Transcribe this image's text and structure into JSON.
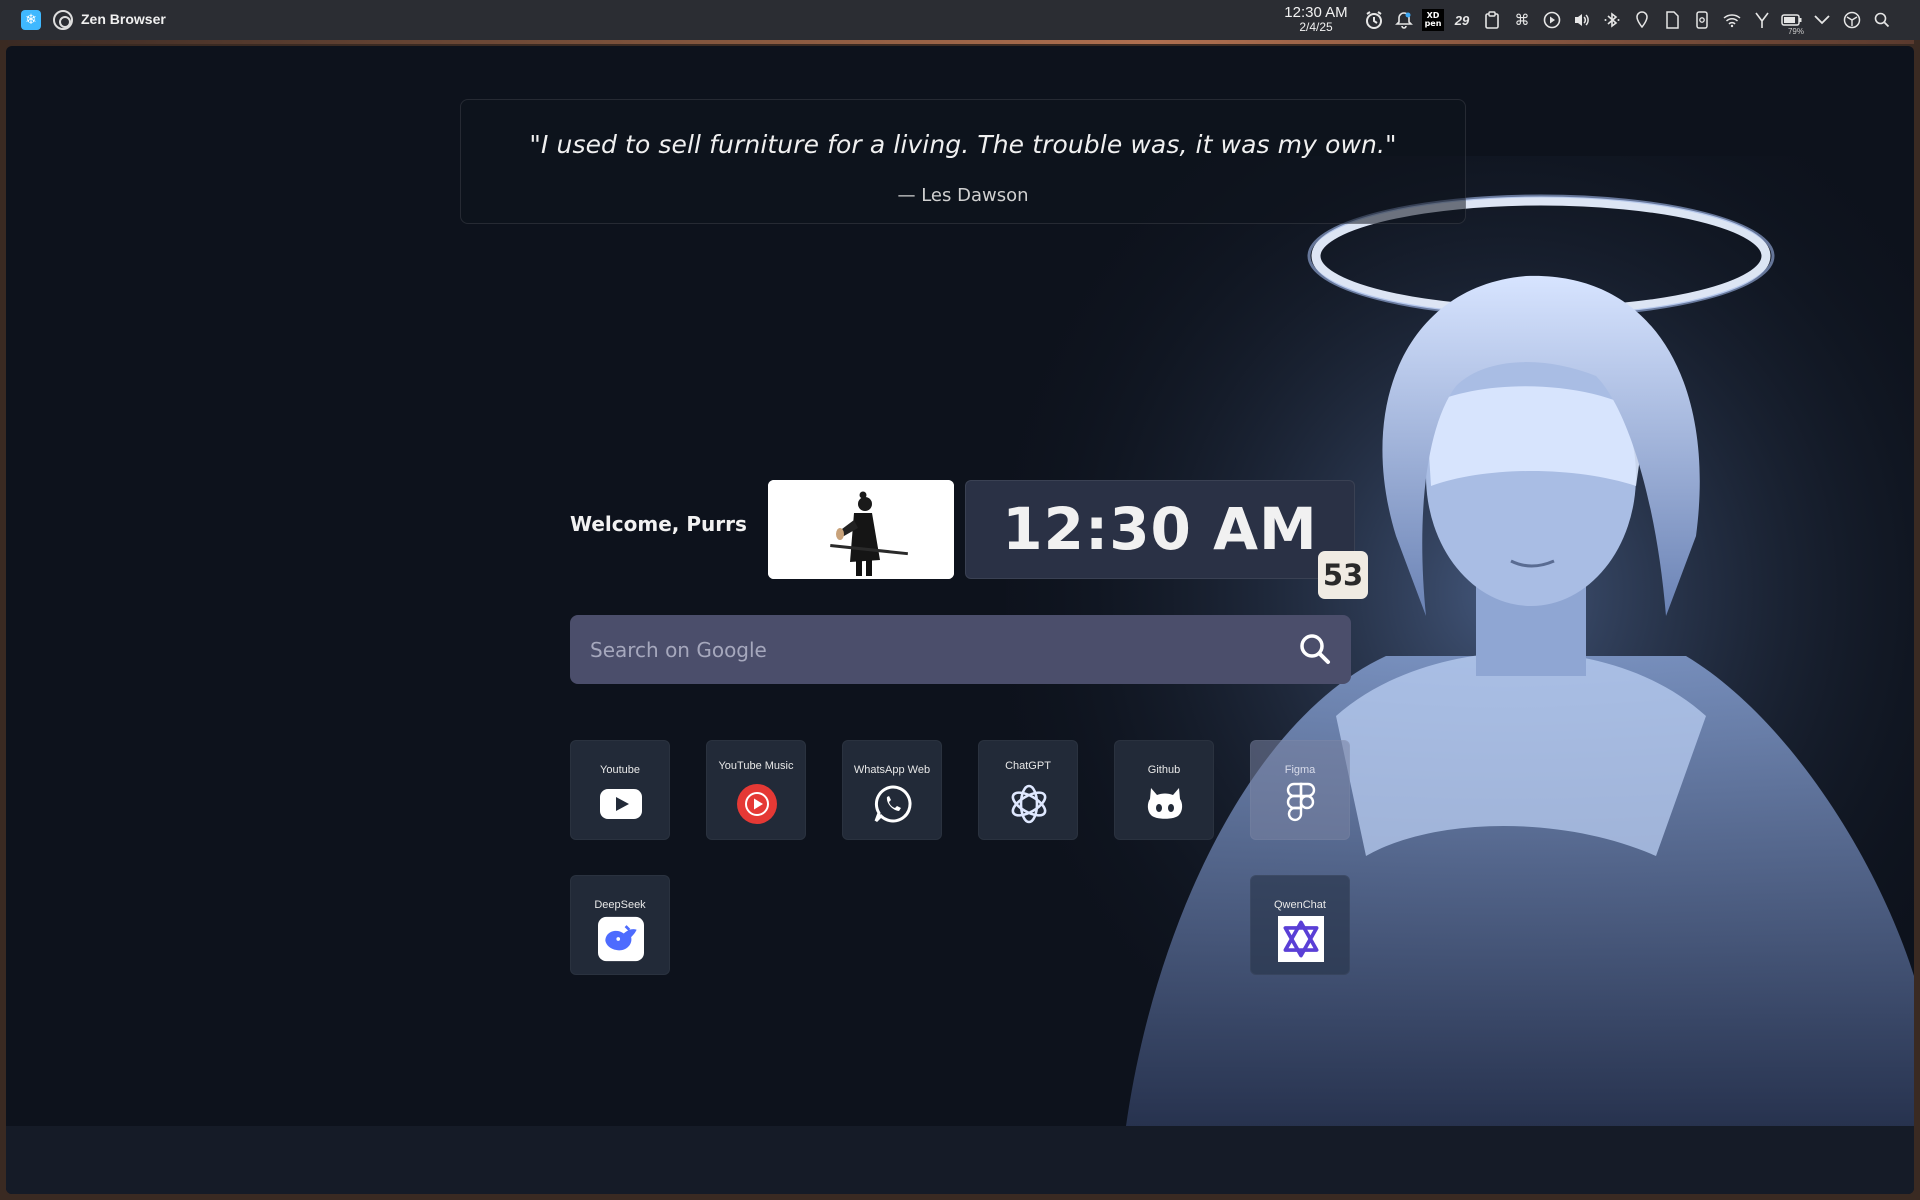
{
  "topbar": {
    "app_title": "Zen Browser",
    "clock_time": "12:30 AM",
    "clock_date": "2/4/25",
    "tray_badge_text": "XD\npen",
    "tray_calendar_number": "29",
    "battery_percent": "79%",
    "launcher_icon": "kde-launcher-icon",
    "app_icon": "zen-browser-icon"
  },
  "quote": {
    "text": "\"I used to sell furniture for a living. The trouble was, it was my own.\"",
    "author": "— Les Dawson"
  },
  "welcome": {
    "greeting": "Welcome, Purrs"
  },
  "clock": {
    "time": "12:30 AM",
    "seconds": "53"
  },
  "search": {
    "placeholder": "Search on Google",
    "value": ""
  },
  "shortcuts": [
    {
      "label": "Youtube",
      "icon": "youtube-icon"
    },
    {
      "label": "YouTube Music",
      "icon": "youtube-music-icon"
    },
    {
      "label": "WhatsApp Web",
      "icon": "whatsapp-icon"
    },
    {
      "label": "ChatGPT",
      "icon": "chatgpt-icon"
    },
    {
      "label": "Github",
      "icon": "github-icon"
    },
    {
      "label": "Figma",
      "icon": "figma-icon"
    },
    {
      "label": "DeepSeek",
      "icon": "deepseek-icon"
    },
    {
      "label": "QwenChat",
      "icon": "qwenchat-icon"
    }
  ],
  "colors": {
    "page_background": "#0d121c",
    "search_bar": "#4b4e6b",
    "clock_card": "#2a3145",
    "seconds_badge": "#f0ebe3",
    "youtube_music_red": "#e53935",
    "deepseek_blue": "#4d6bfe"
  }
}
